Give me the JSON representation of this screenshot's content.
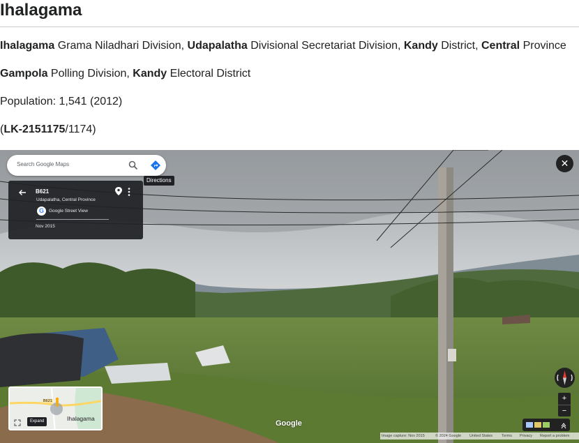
{
  "page": {
    "title": "Ihalagama",
    "line1": {
      "gn": "Ihalagama",
      "gn_suffix": " Grama Niladhari Division, ",
      "ds": "Udapalatha",
      "ds_suffix": " Divisional Secretariat Division, ",
      "district": "Kandy",
      "district_suffix": " District, ",
      "province": "Central",
      "province_suffix": " Province"
    },
    "line2": {
      "polling": "Gampola",
      "polling_suffix": " Polling Division, ",
      "electoral": "Kandy",
      "electoral_suffix": " Electoral District"
    },
    "population": "Population: 1,541 (2012)",
    "code": {
      "open": "(",
      "id": "LK-2151175",
      "rest": "/1174)"
    }
  },
  "streetview": {
    "search_placeholder": "Search Google Maps",
    "directions_tooltip": "Directions",
    "card": {
      "title": "B621",
      "subtitle": "Udapalatha, Central Province",
      "source": "Google Street View",
      "date": "Nov 2015"
    },
    "close_label": "✕",
    "zoom_in_label": "+",
    "zoom_out_label": "−",
    "minimap": {
      "place_label": "Ihalagama",
      "route_badge": "B621",
      "expand_label": "Expand"
    },
    "google_wordmark": "Google",
    "footer": {
      "capture": "Image capture: Nov 2015",
      "copyright": "© 2024 Google",
      "country": "United States",
      "terms": "Terms",
      "privacy": "Privacy",
      "report": "Report a problem"
    },
    "icons": [
      "search-icon",
      "directions-icon",
      "back-arrow-icon",
      "pin-icon",
      "more-vert-icon",
      "google-logo-icon",
      "close-icon",
      "compass-icon",
      "expand-icon",
      "layers-icon"
    ],
    "colors": {
      "accent_blue": "#4285f4",
      "dark_panel": "#202124"
    }
  }
}
